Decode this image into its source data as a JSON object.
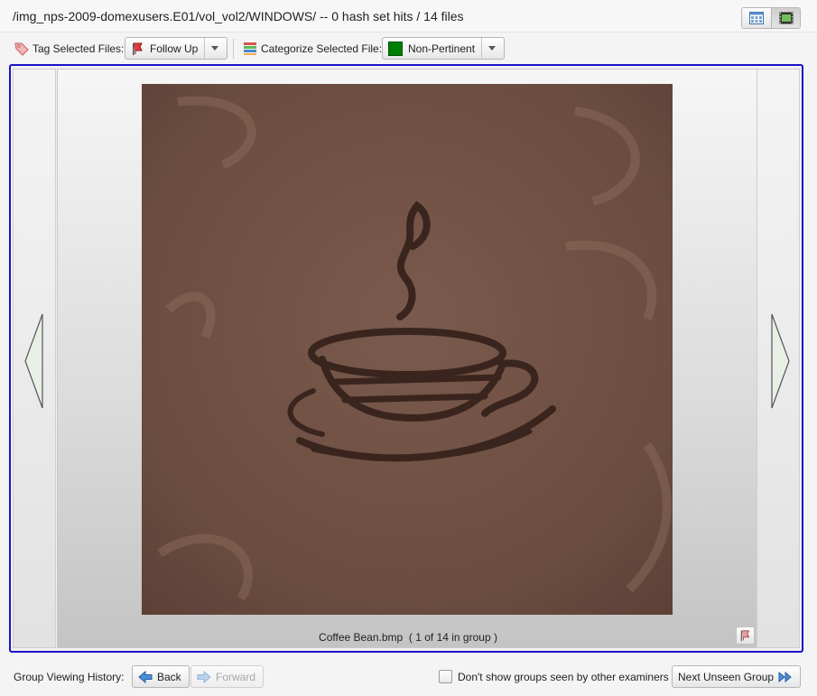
{
  "header": {
    "path_text": "/img_nps-2009-domexusers.E01/vol_vol2/WINDOWS/ -- 0 hash set hits / 14 files",
    "view_buttons": [
      "grid-view-icon",
      "slideshow-view-icon"
    ]
  },
  "toolbar": {
    "tag_label": "Tag Selected Files:",
    "tag_value": "Follow Up",
    "categorize_label": "Categorize Selected File:",
    "category_value": "Non-Pertinent",
    "category_color": "#008000"
  },
  "viewer": {
    "file_name": "Coffee Bean.bmp",
    "position_text": "( 1 of 14 in group )",
    "frame_color": "#1a14c8"
  },
  "footer": {
    "history_label": "Group Viewing History:",
    "back_label": "Back",
    "forward_label": "Forward",
    "dont_show_label": "Don't show groups seen by other examiners",
    "dont_show_checked": false,
    "next_unseen_label": "Next Unseen Group"
  }
}
